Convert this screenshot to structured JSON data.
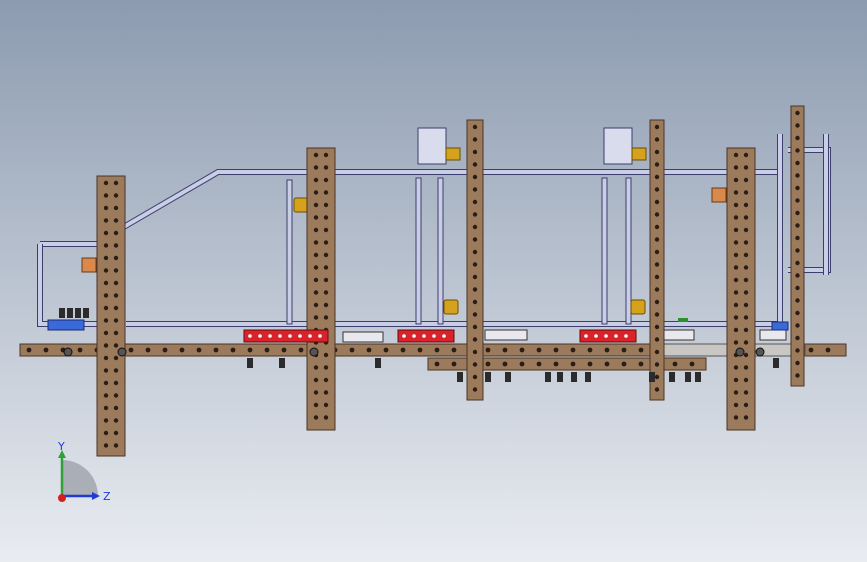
{
  "viewport": {
    "background_top": "#8c9bb0",
    "background_bottom": "#e9ecf1"
  },
  "model": {
    "colors": {
      "wood": "#9c7a5c",
      "wood_edge": "#4a3424",
      "hole": "#2a1d14",
      "steel_tube": "#c9cde6",
      "steel_edge": "#3b3f6b",
      "red_block": "#d8232a",
      "brass": "#d4a21c",
      "copper": "#d9894c",
      "motor": "#d9dcec",
      "fastener": "#2b2b2b",
      "blue_part": "#3a6ad8",
      "green_part": "#2f8f2f"
    }
  },
  "triad": {
    "y_label": "Y",
    "z_label": "Z",
    "y_color": "#2fa03a",
    "z_color": "#1f3ad8",
    "x_color": "#d12020"
  }
}
